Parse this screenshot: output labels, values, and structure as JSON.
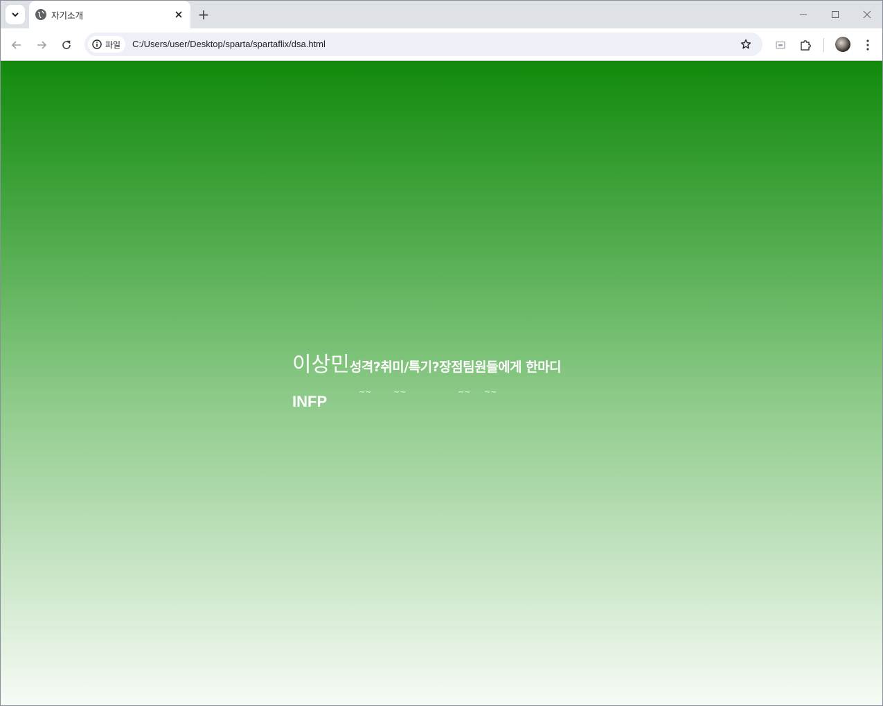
{
  "browser": {
    "tab": {
      "title": "자기소개"
    },
    "new_tab_symbol": "+",
    "address_bar": {
      "chip_label": "파일",
      "url": "C:/Users/user/Desktop/sparta/spartaflix/dsa.html"
    }
  },
  "page": {
    "background_gradient": [
      "#118a0c",
      "#4aa846",
      "#8cca88",
      "#c0e1bd",
      "#f7fbf6"
    ],
    "name": "이상민",
    "headings": "성격?취미/특기?장점팀원들에게 한마디",
    "personality": "INFP",
    "answers": [
      "~~",
      "~~",
      "~~",
      "~~"
    ]
  },
  "icons": {
    "tab_search": "chevron-down-icon",
    "favicon": "globe-icon",
    "back": "arrow-left-icon",
    "forward": "arrow-right-icon",
    "reload": "reload-icon",
    "info": "info-icon",
    "bookmark": "star-icon",
    "cast": "cast-icon",
    "extensions": "puzzle-icon",
    "menu": "kebab-menu-icon"
  }
}
